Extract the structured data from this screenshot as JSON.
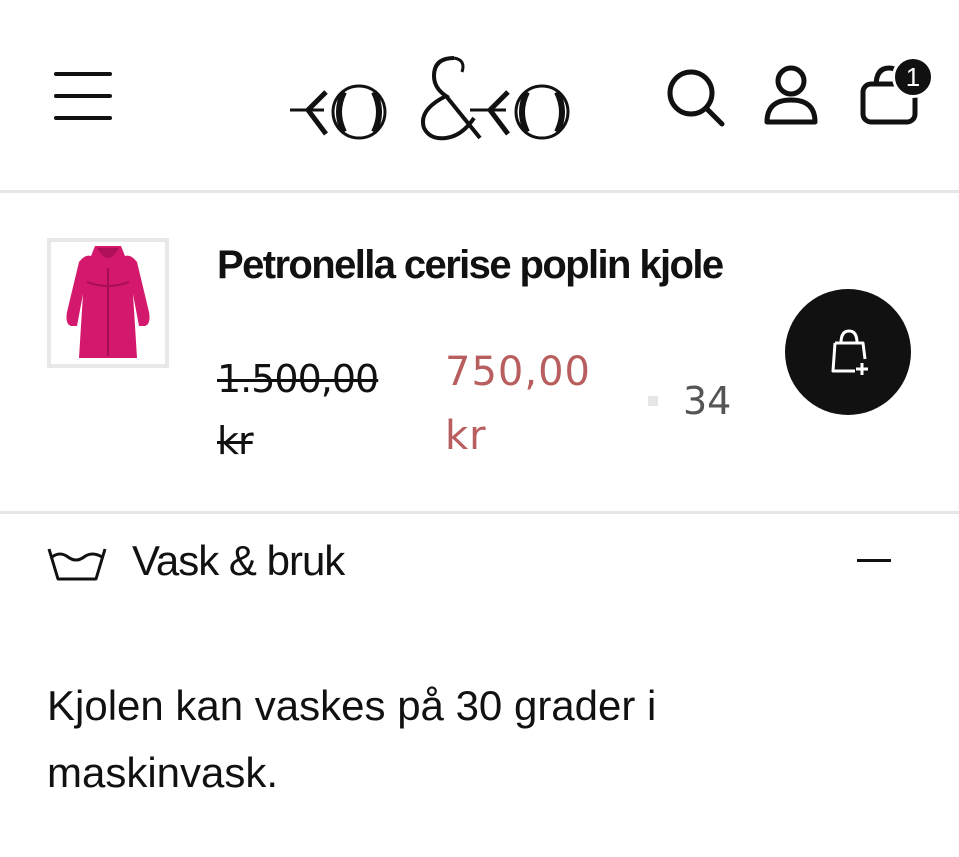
{
  "header": {
    "brand": "KO&KO",
    "cart_count": "1",
    "icons": [
      "menu-icon",
      "search-icon",
      "account-icon",
      "cart-icon"
    ]
  },
  "product": {
    "title": "Petronella cerise poplin kjole",
    "old_price": "1.500,00 kr",
    "sale_price": "750,00 kr",
    "size": "34",
    "add_icon": "bag-plus-icon",
    "colors": {
      "sale": "#b85e5e",
      "dress": "#d4186e"
    }
  },
  "care": {
    "label": "Vask & bruk",
    "icon": "wash-basin-icon",
    "toggle_icon": "minus-icon",
    "text": "Kjolen kan vaskes på 30 grader i maskinvask."
  }
}
